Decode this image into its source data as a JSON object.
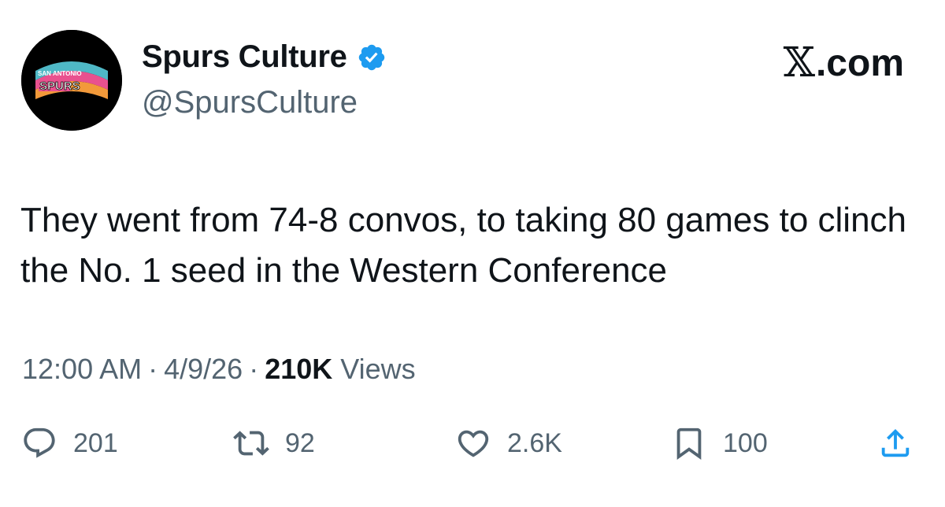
{
  "author": {
    "display_name": "Spurs Culture",
    "handle": "@SpursCulture",
    "verified": true,
    "avatar_text_top": "SAN ANTONIO",
    "avatar_text_main": "SPURS"
  },
  "brand": {
    "x": "𝕏",
    "suffix": ".com"
  },
  "tweet": {
    "text": "They went from 74-8 convos, to taking 80 games to clinch the No. 1 seed in the Western Conference"
  },
  "meta": {
    "time": "12:00 AM",
    "separator": "·",
    "date": "4/9/26",
    "views_count": "210K",
    "views_label": "Views"
  },
  "actions": {
    "replies": "201",
    "reposts": "92",
    "likes": "2.6K",
    "bookmarks": "100"
  },
  "colors": {
    "text": "#0f1419",
    "secondary": "#536471",
    "verified": "#1d9bf0",
    "avatar_bg": "#000000",
    "logo_pink": "#e9518f",
    "logo_teal": "#4fb8c6",
    "logo_orange": "#f2993a"
  }
}
